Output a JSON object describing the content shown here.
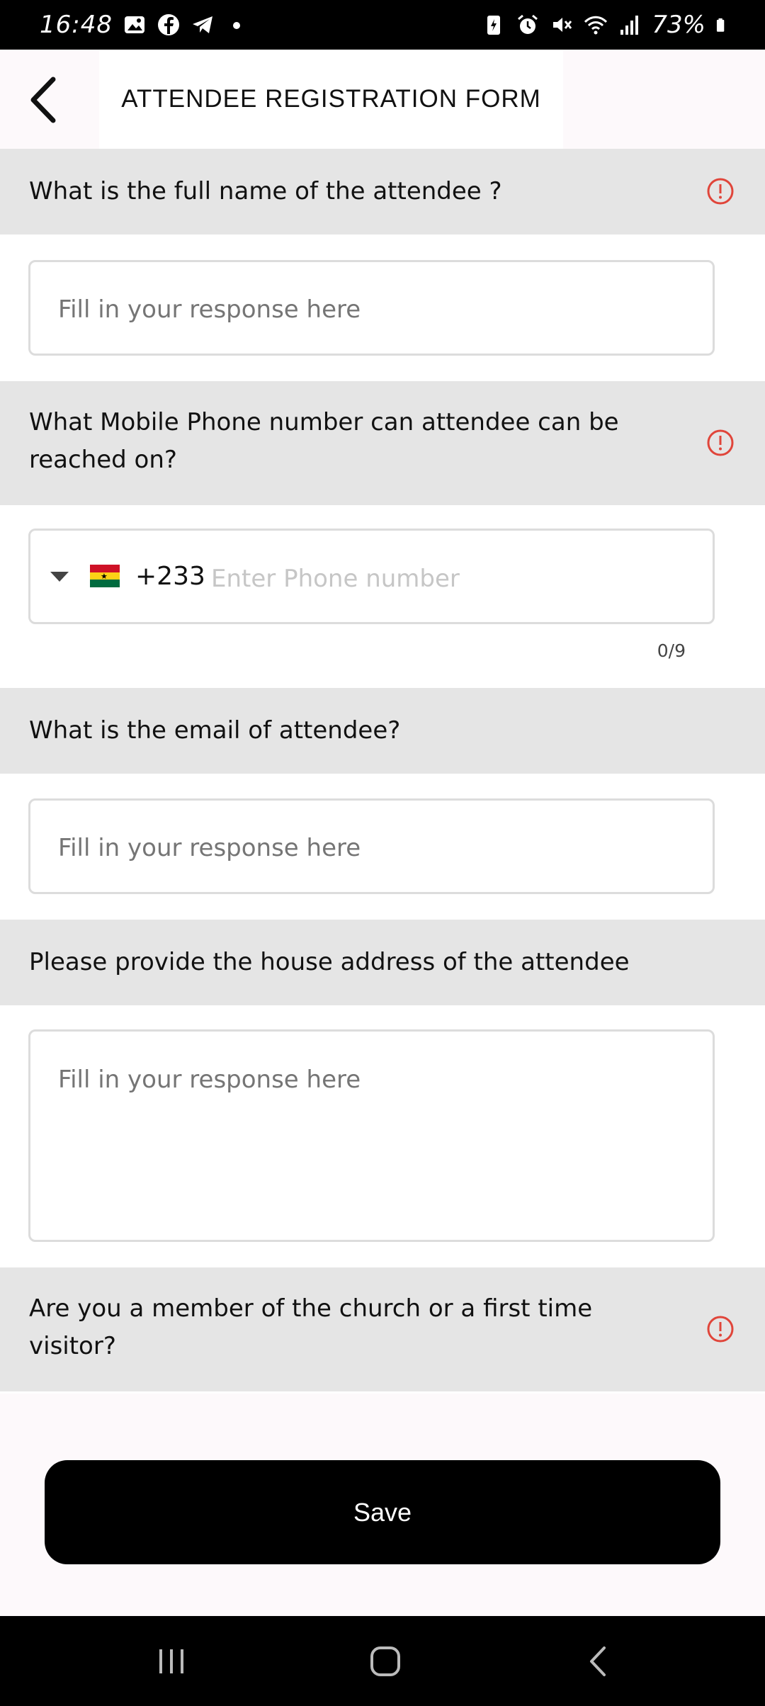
{
  "status_bar": {
    "time": "16:48",
    "battery": "73%"
  },
  "header": {
    "title": "ATTENDEE REGISTRATION FORM"
  },
  "questions": [
    {
      "label": "What is the full name of the attendee ?",
      "placeholder": "Fill in your response here",
      "required_icon": "info-icon"
    },
    {
      "label_line1": "What Mobile Phone number can attendee can be",
      "label_line2": "reached on?",
      "country_code": "+233",
      "placeholder": "Enter Phone number",
      "counter": "0/9",
      "flag_colors": [
        "#ce1126",
        "#fcd116",
        "#006b3f"
      ]
    },
    {
      "label": "What is the email of attendee?",
      "placeholder": "Fill in your response here"
    },
    {
      "label": "Please provide the house address of the attendee",
      "placeholder": "Fill in your response here"
    },
    {
      "label_line1": "Are you a member of the church or a first time",
      "label_line2": "visitor?",
      "required_icon": "info-icon"
    }
  ],
  "actions": {
    "save_label": "Save"
  },
  "colors": {
    "info_icon": "#e0453a",
    "band": "#e5e5e5",
    "button": "#000000"
  }
}
